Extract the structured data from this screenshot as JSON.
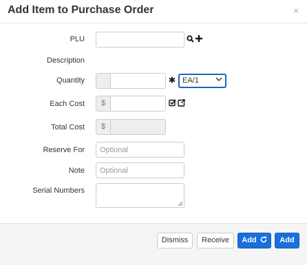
{
  "header": {
    "title": "Add Item to Purchase Order",
    "close_glyph": "×"
  },
  "form": {
    "plu": {
      "label": "PLU",
      "value": "",
      "placeholder": ""
    },
    "description": {
      "label": "Description"
    },
    "quantity": {
      "label": "Quantity",
      "value": "",
      "unit_selected": "EA/1"
    },
    "each_cost": {
      "label": "Each Cost",
      "currency": "$",
      "value": ""
    },
    "total_cost": {
      "label": "Total Cost",
      "currency": "$",
      "value": ""
    },
    "reserve_for": {
      "label": "Reserve For",
      "placeholder": "Optional"
    },
    "note": {
      "label": "Note",
      "placeholder": "Optional"
    },
    "serial_numbers": {
      "label": "Serial Numbers",
      "value": ""
    }
  },
  "icons": {
    "plu": [
      "search-icon",
      "plus-icon"
    ],
    "quantity": [
      "asterisk-icon"
    ],
    "each_cost": [
      "checkbox-edit-icon",
      "external-link-icon"
    ]
  },
  "footer": {
    "dismiss_label": "Dismiss",
    "receive_label": "Receive",
    "add_repeat_label": "Add",
    "add_label": "Add"
  },
  "colors": {
    "primary": "#1a6fdc",
    "focus_border": "#1d63c4",
    "footer_bg": "#f5f5f5"
  }
}
